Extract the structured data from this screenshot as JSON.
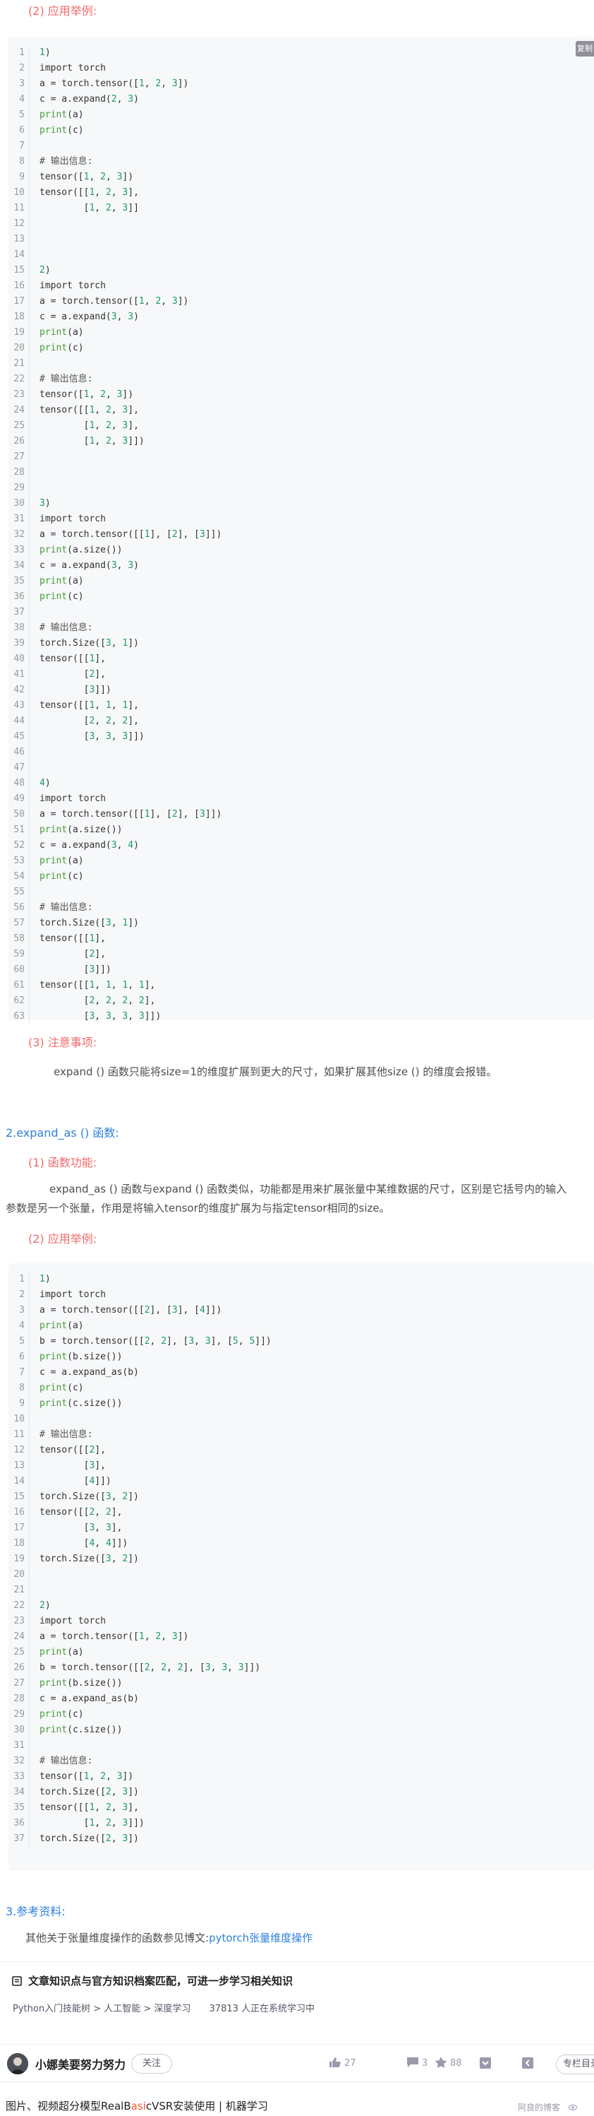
{
  "section_expand": {
    "example_heading": "(2) 应用举例:",
    "notes_heading": "(3) 注意事项:",
    "notes_text": "expand () 函数只能将size=1的维度扩展到更大的尺寸，如果扩展其他size () 的维度会报错。"
  },
  "copy_label": "复制",
  "code_block_1": [
    "1)",
    "import torch",
    "a = torch.tensor([1, 2, 3])",
    "c = a.expand(2, 3)",
    "print(a)",
    "print(c)",
    "",
    "# 输出信息:",
    "tensor([1, 2, 3])",
    "tensor([[1, 2, 3],",
    "        [1, 2, 3]]",
    "",
    "",
    "",
    "2)",
    "import torch",
    "a = torch.tensor([1, 2, 3])",
    "c = a.expand(3, 3)",
    "print(a)",
    "print(c)",
    "",
    "# 输出信息:",
    "tensor([1, 2, 3])",
    "tensor([[1, 2, 3],",
    "        [1, 2, 3],",
    "        [1, 2, 3]])",
    "",
    "",
    "",
    "3)",
    "import torch",
    "a = torch.tensor([[1], [2], [3]])",
    "print(a.size())",
    "c = a.expand(3, 3)",
    "print(a)",
    "print(c)",
    "",
    "# 输出信息:",
    "torch.Size([3, 1])",
    "tensor([[1],",
    "        [2],",
    "        [3]])",
    "tensor([[1, 1, 1],",
    "        [2, 2, 2],",
    "        [3, 3, 3]])",
    "",
    "",
    "4)",
    "import torch",
    "a = torch.tensor([[1], [2], [3]])",
    "print(a.size())",
    "c = a.expand(3, 4)",
    "print(a)",
    "print(c)",
    "",
    "# 输出信息:",
    "torch.Size([3, 1])",
    "tensor([[1],",
    "        [2],",
    "        [3]])",
    "tensor([[1, 1, 1, 1],",
    "        [2, 2, 2, 2],",
    "        [3, 3, 3, 3]])"
  ],
  "section_expand_as": {
    "heading": "2.expand_as () 函数:",
    "function_heading": "(1) 函数功能:",
    "function_text_1": "expand_as () 函数与expand () 函数类似，功能都是用来扩展张量中某维数据的尺寸，区别是它括号内的输入",
    "function_text_2": "参数是另一个张量，作用是将输入tensor的维度扩展为与指定tensor相同的size。",
    "example_heading": "(2) 应用举例:"
  },
  "code_block_2": [
    "1)",
    "import torch",
    "a = torch.tensor([[2], [3], [4]])",
    "print(a)",
    "b = torch.tensor([[2, 2], [3, 3], [5, 5]])",
    "print(b.size())",
    "c = a.expand_as(b)",
    "print(c)",
    "print(c.size())",
    "",
    "# 输出信息:",
    "tensor([[2],",
    "        [3],",
    "        [4]])",
    "torch.Size([3, 2])",
    "tensor([[2, 2],",
    "        [3, 3],",
    "        [4, 4]])",
    "torch.Size([3, 2])",
    "",
    "",
    "2)",
    "import torch",
    "a = torch.tensor([1, 2, 3])",
    "print(a)",
    "b = torch.tensor([[2, 2, 2], [3, 3, 3]])",
    "print(b.size())",
    "c = a.expand_as(b)",
    "print(c)",
    "print(c.size())",
    "",
    "# 输出信息:",
    "tensor([1, 2, 3])",
    "torch.Size([2, 3])",
    "tensor([[1, 2, 3],",
    "        [1, 2, 3]])",
    "torch.Size([2, 3])"
  ],
  "references": {
    "heading": "3.参考资料:",
    "text_prefix": "其他关于张量维度操作的函数参见博文:",
    "link_text": "pytorch张量维度操作"
  },
  "knowledge": {
    "title": "文章知识点与官方知识档案匹配，可进一步学习相关知识",
    "path": "Python入门技能树 > 人工智能 > 深度学习",
    "learners": "37813 人正在系统学习中"
  },
  "footer": {
    "author": "小娜美要努力努力",
    "follow_label": "关注",
    "likes": "27",
    "comments": "3",
    "favorites": "88",
    "column_label": "专栏目录"
  },
  "recommendation": {
    "title_before": "图片、视频超分模型RealB",
    "title_highlight": "asi",
    "title_after": "cVSR安装使用 | 机器学习",
    "meta": "阿良的博客"
  }
}
